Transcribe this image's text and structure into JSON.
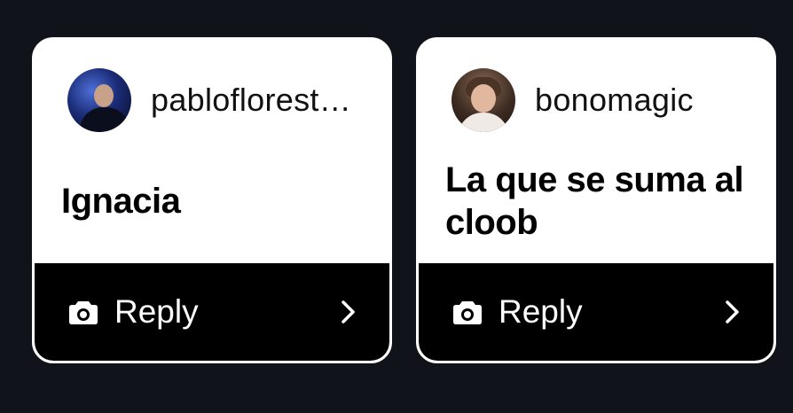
{
  "cards": [
    {
      "username": "pabloflorest…",
      "message": "Ignacia",
      "reply_label": "Reply"
    },
    {
      "username": "bonomagic",
      "message": "La que se suma al cloob",
      "reply_label": "Reply"
    }
  ],
  "icons": {
    "camera": "camera-icon",
    "chevron": "chevron-right-icon"
  },
  "colors": {
    "background": "#10141a",
    "card": "#ffffff",
    "reply_bar": "#000000"
  }
}
